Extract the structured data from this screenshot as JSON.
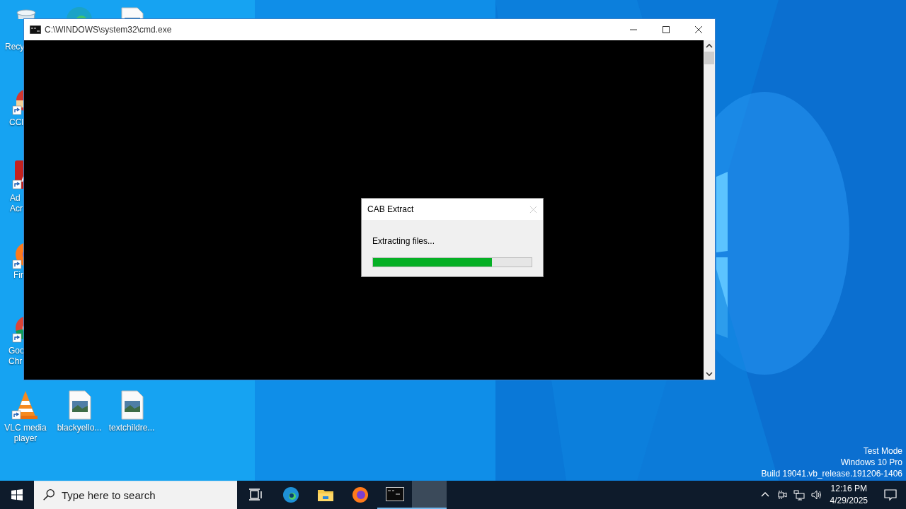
{
  "desktop": {
    "icons": [
      {
        "kind": "recycle-bin",
        "label_lines": [
          "Recy"
        ]
      },
      {
        "kind": "edge"
      },
      {
        "kind": "document"
      },
      {
        "kind": "ccleaner",
        "shortcut": true,
        "label_lines": [
          "CCl"
        ]
      },
      {
        "kind": "acrobat",
        "shortcut": true,
        "label_lines": [
          "Ad",
          "Acr"
        ]
      },
      {
        "kind": "firefox",
        "shortcut": true,
        "label_lines": [
          "Fir"
        ]
      },
      {
        "kind": "chrome",
        "shortcut": true,
        "label_lines": [
          "Goo",
          "Chr"
        ]
      },
      {
        "kind": "vlc",
        "shortcut": true,
        "label_lines": [
          "VLC media",
          "player"
        ]
      },
      {
        "kind": "image-file",
        "shortcut": false,
        "label_lines": [
          "blackyello..."
        ]
      },
      {
        "kind": "image-file",
        "shortcut": false,
        "label_lines": [
          "textchildre..."
        ]
      }
    ]
  },
  "console_window": {
    "title": "C:\\WINDOWS\\system32\\cmd.exe"
  },
  "dialog": {
    "title": "CAB Extract",
    "close_disabled": true,
    "message": "Extracting files...",
    "progress": {
      "level": 0.75
    }
  },
  "system_notice": [
    "Test Mode",
    "Windows 10 Pro",
    "Build 19041.vb_release.191206-1406"
  ],
  "taskbar": {
    "search": {
      "placeholder": "Type here to search"
    },
    "apps": [
      {
        "kind": "task-view",
        "running": false,
        "selected": false
      },
      {
        "kind": "edge",
        "running": false,
        "selected": false
      },
      {
        "kind": "explorer",
        "running": false,
        "selected": false
      },
      {
        "kind": "firefox",
        "running": false,
        "selected": false
      },
      {
        "kind": "console",
        "running": true,
        "selected": false
      },
      {
        "kind": "blank",
        "running": true,
        "selected": true
      }
    ],
    "tray": {
      "time": "12:16 PM",
      "date": "4/29/2025"
    }
  }
}
